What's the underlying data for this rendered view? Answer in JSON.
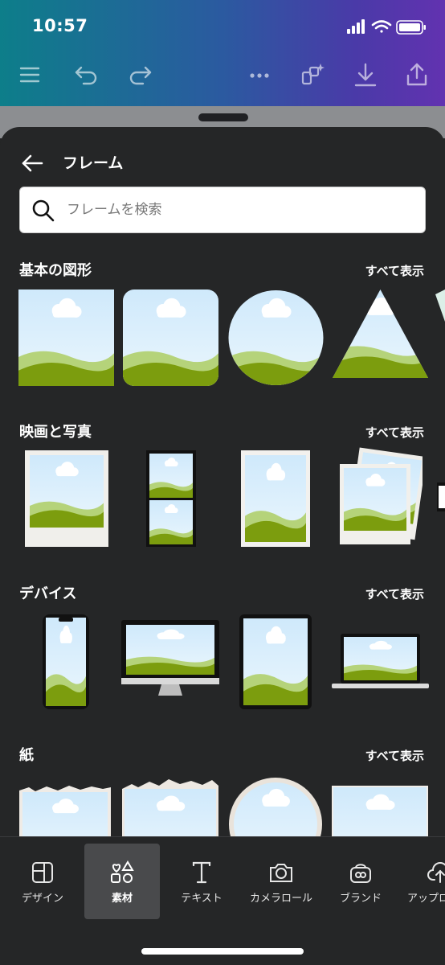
{
  "status": {
    "time": "10:57"
  },
  "toolbar": {
    "icons": [
      "menu-icon",
      "undo-icon",
      "redo-icon",
      "more-icon",
      "magic-resize-icon",
      "download-icon",
      "share-icon"
    ]
  },
  "panel": {
    "title": "フレーム",
    "search_placeholder": "フレームを検索"
  },
  "sections": [
    {
      "title": "基本の図形",
      "see_all": "すべて表示"
    },
    {
      "title": "映画と写真",
      "see_all": "すべて表示"
    },
    {
      "title": "デバイス",
      "see_all": "すべて表示"
    },
    {
      "title": "紙",
      "see_all": "すべて表示"
    }
  ],
  "nav": {
    "items": [
      {
        "label": "デザイン",
        "icon": "design-icon"
      },
      {
        "label": "素材",
        "icon": "elements-icon",
        "active": true
      },
      {
        "label": "テキスト",
        "icon": "text-icon"
      },
      {
        "label": "カメラロール",
        "icon": "camera-icon"
      },
      {
        "label": "ブランド",
        "icon": "brand-icon"
      },
      {
        "label": "アップロ",
        "icon": "upload-icon"
      }
    ]
  },
  "colors": {
    "sky": "#cfe9fb",
    "hill_light": "#b5d37a",
    "hill_dark": "#7c9d0e",
    "sheet_bg": "#252627"
  }
}
